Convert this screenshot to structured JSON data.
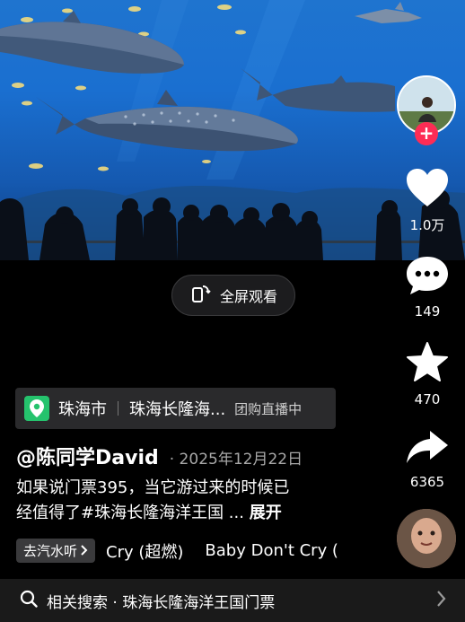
{
  "video": {
    "fullscreen_label": "全屏观看"
  },
  "author": {
    "follow_symbol": "+"
  },
  "actions": {
    "likes": "1.0万",
    "comments": "149",
    "favorites": "470",
    "shares": "6365"
  },
  "location": {
    "city": "珠海市",
    "place": "珠海长隆海...",
    "live_badge": "团购直播中"
  },
  "post": {
    "username": "@陈同学David",
    "date": "· 2025年12月22日",
    "desc_line1": "如果说门票395，当它游过来的时候已",
    "desc_line2": "经值得了#珠海长隆海洋王国 ...",
    "more_label": "展开"
  },
  "music": {
    "chip_label": "去汽水听",
    "track1": "Cry (超燃)",
    "track2": "Baby Don't Cry ("
  },
  "search": {
    "label": "相关搜索 · 珠海长隆海洋王国门票"
  },
  "colors": {
    "accent": "#fe2c55",
    "location_green": "#25c36d",
    "background": "#000000"
  }
}
